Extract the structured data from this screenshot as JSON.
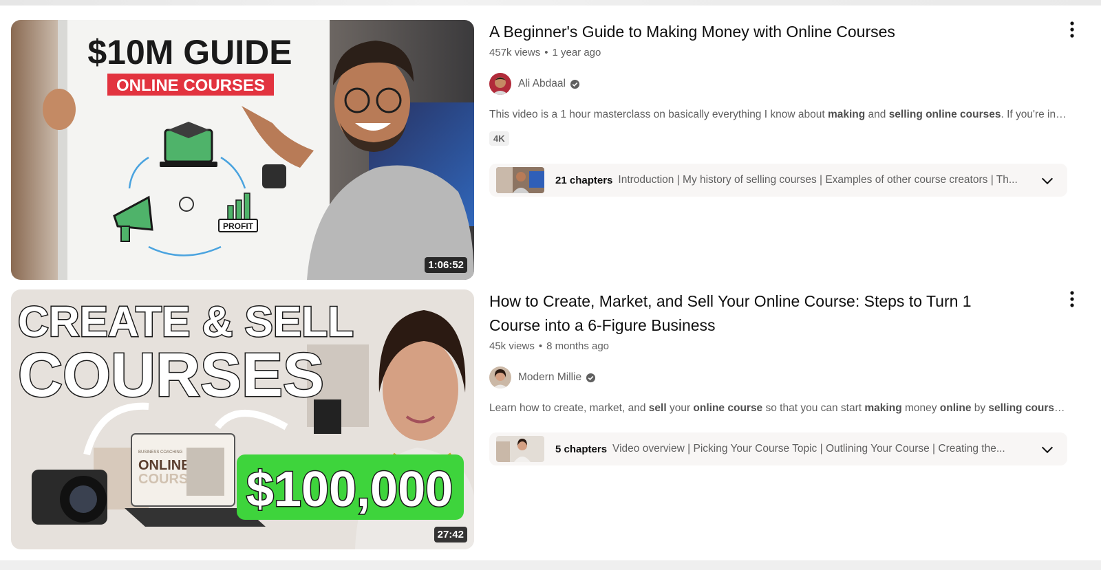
{
  "results": [
    {
      "title": "A Beginner's Guide to Making Money with Online Courses",
      "views": "457k views",
      "age": "1 year ago",
      "duration": "1:06:52",
      "channel": "Ali Abdaal",
      "description_parts": [
        {
          "text": "This video is a 1 hour masterclass on basically everything I know about ",
          "bold": false
        },
        {
          "text": "making",
          "bold": true
        },
        {
          "text": " and ",
          "bold": false
        },
        {
          "text": "selling online courses",
          "bold": true
        },
        {
          "text": ". If you're int...",
          "bold": false
        }
      ],
      "badge": "4K",
      "chapters_count": "21 chapters",
      "chapters_list": "Introduction | My history of selling courses | Examples of other course creators | Th...",
      "thumb_text": {
        "line1": "$10M GUIDE",
        "line2": "ONLINE COURSES",
        "profit": "PROFIT"
      }
    },
    {
      "title": "How to Create, Market, and Sell Your Online Course: Steps to Turn 1 Course into a 6-Figure Business",
      "views": "45k views",
      "age": "8 months ago",
      "duration": "27:42",
      "channel": "Modern Millie",
      "description_parts": [
        {
          "text": "Learn how to create, market, and ",
          "bold": false
        },
        {
          "text": "sell",
          "bold": true
        },
        {
          "text": " your ",
          "bold": false
        },
        {
          "text": "online course",
          "bold": true
        },
        {
          "text": " so that you can start ",
          "bold": false
        },
        {
          "text": "making",
          "bold": true
        },
        {
          "text": " money ",
          "bold": false
        },
        {
          "text": "online",
          "bold": true
        },
        {
          "text": " by ",
          "bold": false
        },
        {
          "text": "selling courses",
          "bold": true
        },
        {
          "text": "...",
          "bold": false
        }
      ],
      "chapters_count": "5 chapters",
      "chapters_list": "Video overview | Picking Your Course Topic | Outlining Your Course | Creating the...",
      "thumb_text": {
        "line1": "CREATE & SELL",
        "line2": "COURSES",
        "amount": "$100,000",
        "screen1": "ONLINE",
        "screen2": "COURSE",
        "screen_small": "BUSINESS COACHING"
      }
    }
  ],
  "icons": {
    "more": "more-vert-icon",
    "verified": "verified-check-icon",
    "chevron": "chevron-down-icon"
  },
  "colors": {
    "text_primary": "#0f0f0f",
    "text_secondary": "#606060",
    "red_label": "#e2333f",
    "green_price": "#3ed43c"
  }
}
